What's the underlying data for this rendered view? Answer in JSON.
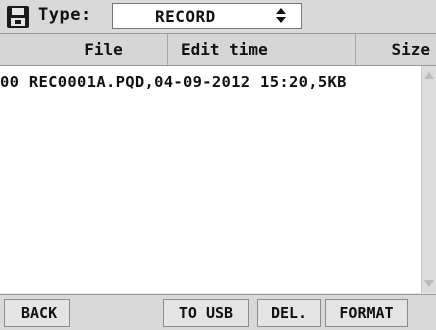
{
  "toolbar": {
    "type_label": "Type:",
    "type_value": "RECORD"
  },
  "columns": {
    "file": "File",
    "edit_time": "Edit time",
    "size": "Size"
  },
  "files": [
    {
      "text": "00 REC0001A.PQD,04-09-2012 15:20,5KB"
    }
  ],
  "buttons": {
    "back": "BACK",
    "to_usb": "TO USB",
    "delete": "DEL.",
    "format": "FORMAT"
  },
  "icons": {
    "save": "floppy-disk-icon",
    "spinner": "spinner-arrows-icon"
  }
}
